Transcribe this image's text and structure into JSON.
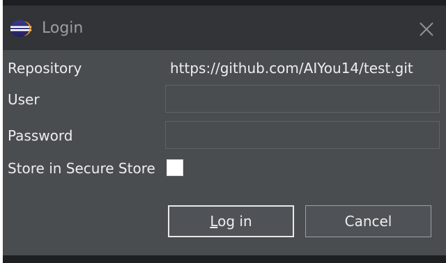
{
  "window": {
    "title": "Login",
    "app_icon": "eclipse-icon",
    "close_icon": "close-icon",
    "close_glyph": "✕"
  },
  "form": {
    "repository_label": "Repository",
    "repository_value": "https://github.com/AIYou14/test.git",
    "user_label": "User",
    "user_value": "",
    "password_label": "Password",
    "password_value": "",
    "store_label": "Store in Secure Store",
    "store_checked": false
  },
  "buttons": {
    "login_mnemonic": "L",
    "login_rest": "og in",
    "cancel_label": "Cancel"
  },
  "colors": {
    "titlebar": "#323437",
    "dialog_body": "#4a4d50",
    "text": "#eeeeee",
    "title_text": "#9b9ea2"
  }
}
